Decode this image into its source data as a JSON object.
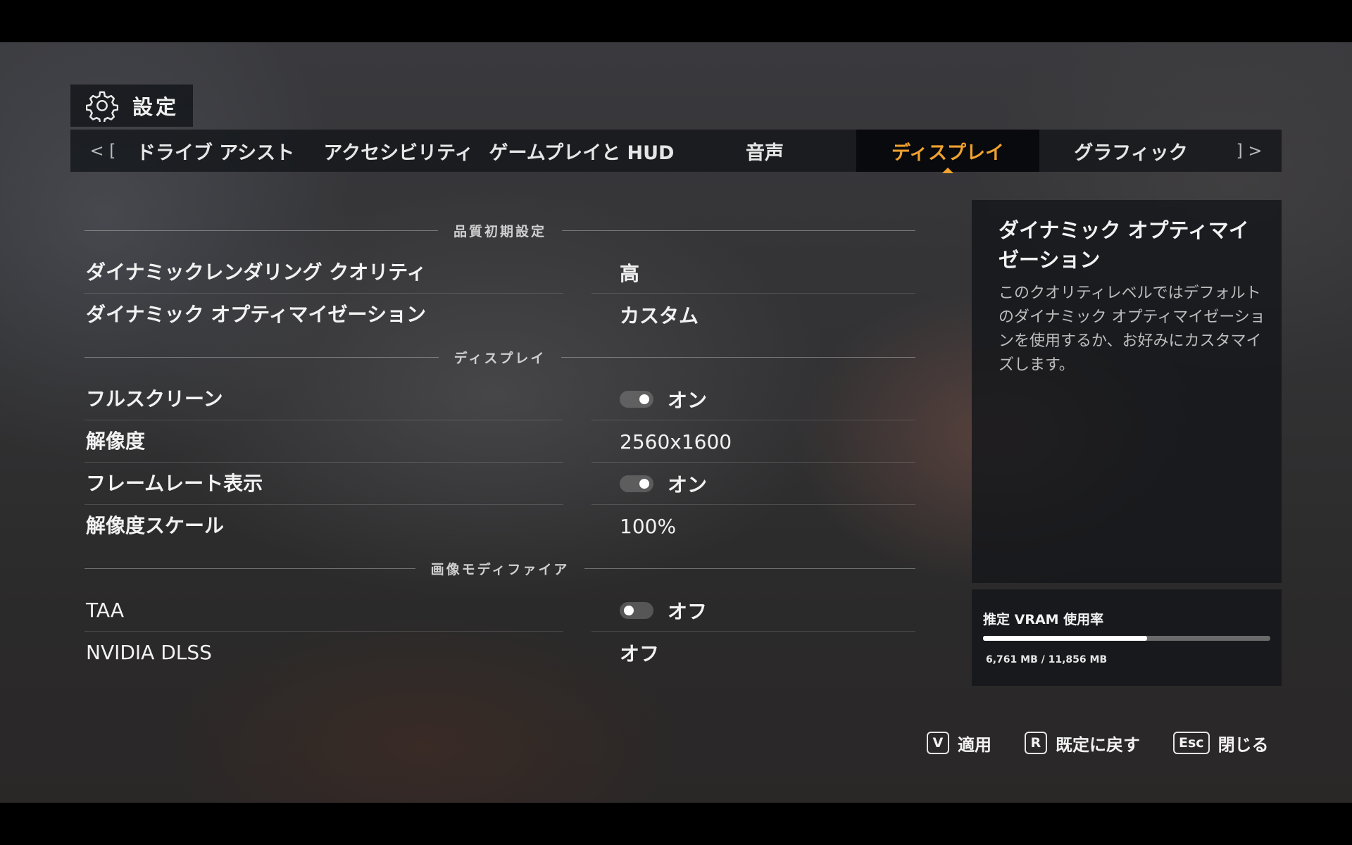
{
  "header": {
    "title": "設定"
  },
  "tabs": {
    "prev_nav": "< [",
    "next_nav": "] >",
    "items": [
      {
        "label": "ドライブ アシスト",
        "active": false
      },
      {
        "label": "アクセシビリティ",
        "active": false
      },
      {
        "label": "ゲームプレイと HUD",
        "active": false
      },
      {
        "label": "音声",
        "active": false
      },
      {
        "label": "ディスプレイ",
        "active": true
      },
      {
        "label": "グラフィック",
        "active": false
      }
    ]
  },
  "sections": {
    "preset": "品質初期設定",
    "display": "ディスプレイ",
    "modifiers": "画像モディファイア"
  },
  "settings": {
    "dynamic_rendering_quality": {
      "name": "ダイナミックレンダリング クオリティ",
      "value": "高"
    },
    "dynamic_optimization": {
      "name": "ダイナミック オプティマイゼーション",
      "value": "カスタム"
    },
    "fullscreen": {
      "name": "フルスクリーン",
      "value": "オン",
      "toggle_on": true
    },
    "resolution": {
      "name": "解像度",
      "value": "2560x1600"
    },
    "framerate_display": {
      "name": "フレームレート表示",
      "value": "オン",
      "toggle_on": true
    },
    "resolution_scale": {
      "name": "解像度スケール",
      "value": "100%"
    },
    "taa": {
      "name": "TAA",
      "value": "オフ",
      "toggle_on": false
    },
    "nvidia_dlss": {
      "name": "NVIDIA DLSS",
      "value": "オフ"
    }
  },
  "info": {
    "title": "ダイナミック オプティマイゼーション",
    "description": "このクオリティレベルではデフォルトのダイナミック オプティマイゼーションを使用するか、お好みにカスタマイズします。"
  },
  "vram": {
    "label": "推定 VRAM 使用率",
    "usage_text": "6,761 MB / 11,856 MB",
    "used_mb": 6761,
    "total_mb": 11856
  },
  "footer": {
    "apply": {
      "key": "V",
      "label": "適用"
    },
    "reset": {
      "key": "R",
      "label": "既定に戻す"
    },
    "close": {
      "key": "Esc",
      "label": "閉じる"
    }
  },
  "colors": {
    "accent": "#f0a22e"
  }
}
